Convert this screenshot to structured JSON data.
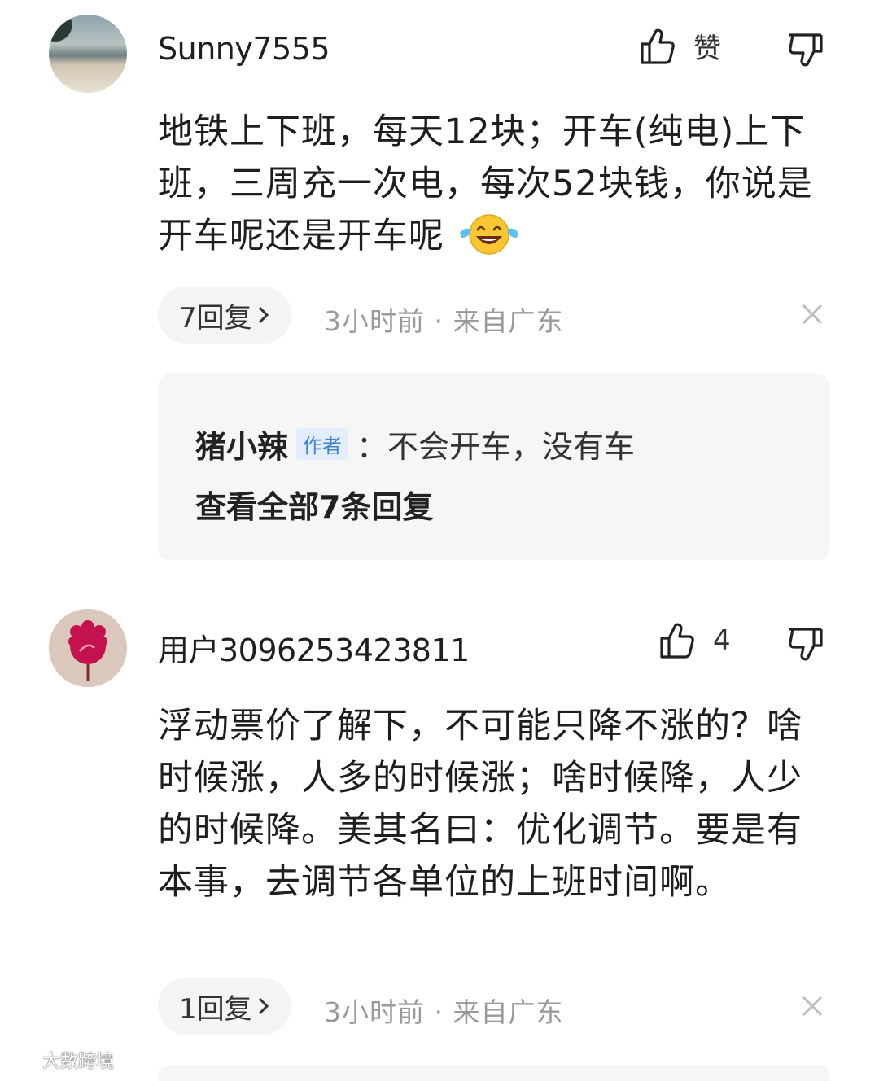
{
  "comments": [
    {
      "username": "Sunny7555",
      "like_label": "赞",
      "text": "地铁上下班，每天12块；开车(纯电)上下班，三周充一次电，每次52块钱，你说是开车呢还是开车呢",
      "emoji": "laughing-with-tears-emoji",
      "reply_count_label": "7回复",
      "meta": "3小时前 · 来自广东",
      "reply_preview": {
        "author": "猪小辣",
        "badge": "作者",
        "text": "：不会开车，没有车",
        "view_all": "查看全部7条回复"
      }
    },
    {
      "username": "用户3096253423811",
      "like_label": "4",
      "text": "浮动票价了解下，不可能只降不涨的？啥时候涨，人多的时候涨；啥时候降，人少的时候降。美其名曰：优化调节。要是有本事，去调节各单位的上班时间啊。",
      "reply_count_label": "1回复",
      "meta": "3小时前 · 来自广东"
    }
  ],
  "watermark": "大数跨境",
  "icons": {
    "like": "thumbs-up-icon",
    "dislike": "thumbs-down-icon",
    "close": "close-icon",
    "chevron": "chevron-right-icon"
  }
}
